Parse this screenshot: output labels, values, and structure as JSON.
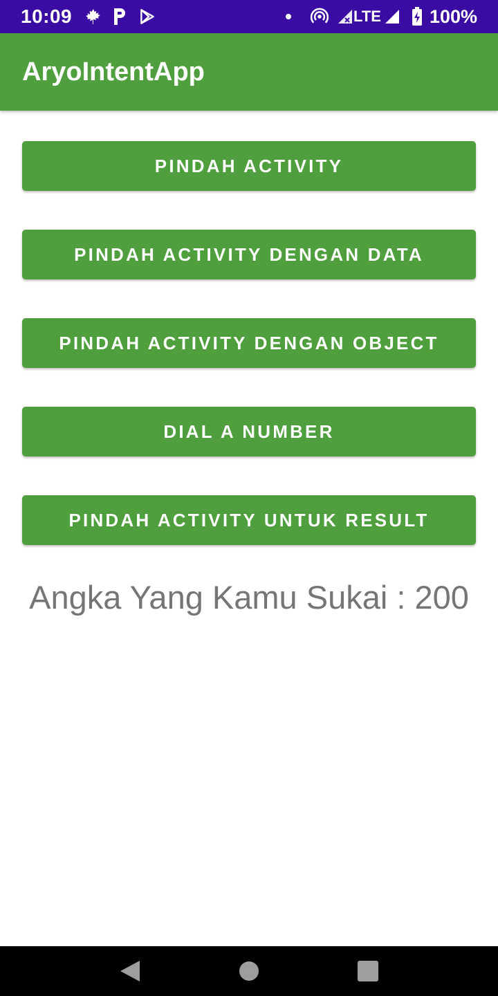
{
  "status_bar": {
    "time": "10:09",
    "battery": "100%",
    "network": "LTE",
    "left_icons": [
      "maple-leaf-icon",
      "parking-icon",
      "play-store-icon"
    ],
    "right_icons": [
      "notification-dot-icon",
      "hotspot-icon",
      "signal-icon",
      "battery-charging-icon"
    ]
  },
  "app_bar": {
    "title": "AryoIntentApp"
  },
  "buttons": [
    {
      "label": "PINDAH ACTIVITY"
    },
    {
      "label": "PINDAH ACTIVITY DENGAN DATA"
    },
    {
      "label": "PINDAH ACTIVITY DENGAN OBJECT"
    },
    {
      "label": "DIAL A NUMBER"
    },
    {
      "label": "PINDAH ACTIVITY UNTUK RESULT"
    }
  ],
  "result": {
    "text": "Angka Yang Kamu Sukai : 200"
  },
  "nav_bar": {
    "icons": [
      "back-icon",
      "home-icon",
      "recents-icon"
    ]
  },
  "colors": {
    "status_bar": "#3a0ca3",
    "primary": "#4f9f3f",
    "result_text": "#757575"
  }
}
